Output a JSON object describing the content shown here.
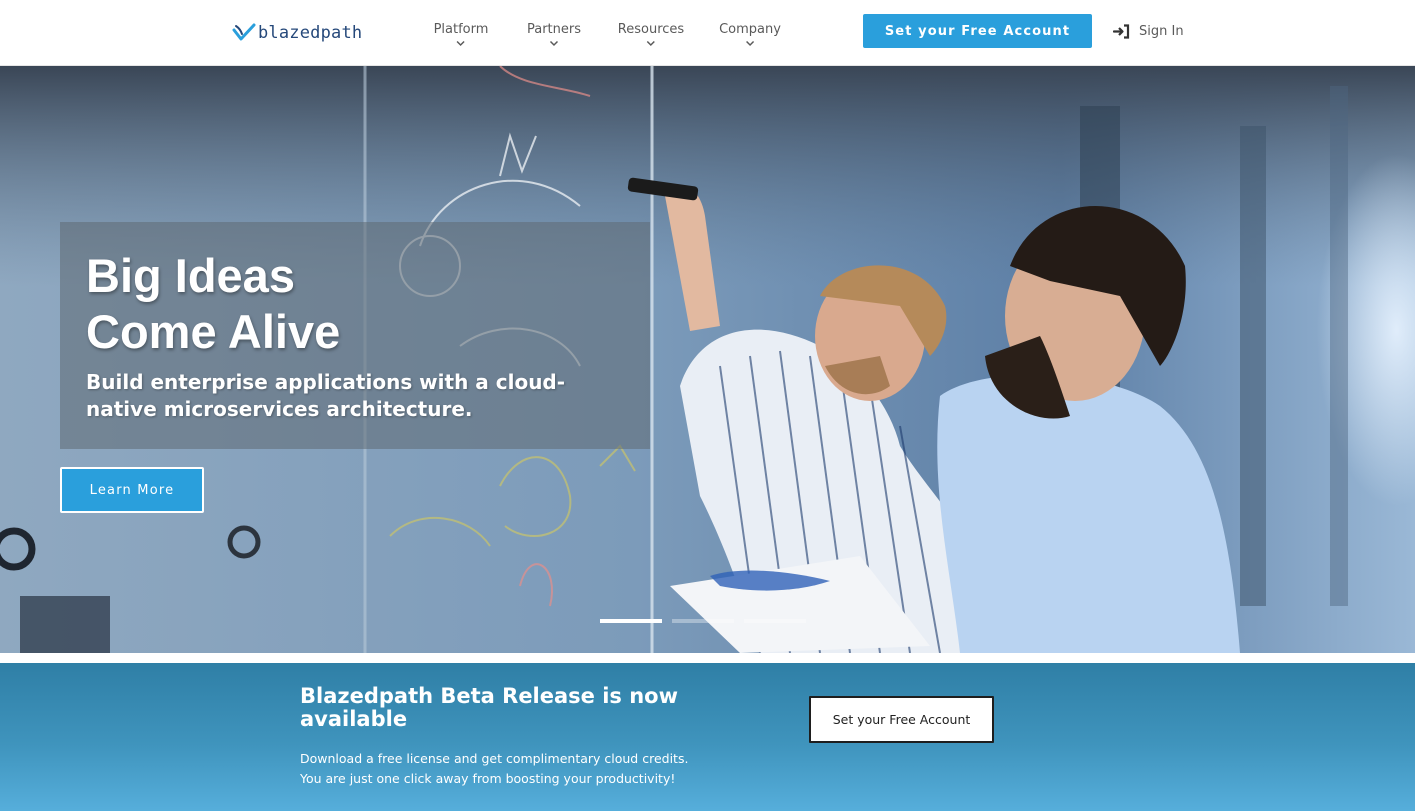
{
  "header": {
    "logo_text": "blazedpath",
    "logo_icon": "bird-checkmark-logo",
    "nav": [
      {
        "label": "Platform",
        "icon": "chevron-down-icon"
      },
      {
        "label": "Partners",
        "icon": "chevron-down-icon"
      },
      {
        "label": "Resources",
        "icon": "chevron-down-icon"
      },
      {
        "label": "Company",
        "icon": "chevron-down-icon"
      }
    ],
    "cta_label": "Set your Free Account",
    "signin_label": "Sign In",
    "signin_icon": "sign-in-icon"
  },
  "hero": {
    "title_line1": "Big Ideas",
    "title_line2": "Come Alive",
    "subtitle": "Build enterprise applications with a cloud-native microservices architecture.",
    "button_label": "Learn More",
    "slide_count": 3,
    "active_slide": 1
  },
  "promo": {
    "title": "Blazedpath Beta Release is now available",
    "desc_line1": "Download a free license and get complimentary cloud credits.",
    "desc_line2": "You are just one click away from boosting your productivity!",
    "button_label": "Set your Free Account"
  },
  "colors": {
    "brand_blue": "#2a9fdc",
    "logo_text": "#25487a",
    "nav_text": "#5a5a5a",
    "promo_band_top": "#2f7fa6",
    "promo_band_bottom": "#56aedb"
  }
}
